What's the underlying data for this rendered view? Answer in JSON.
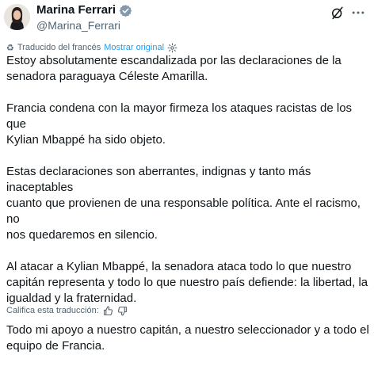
{
  "user": {
    "display_name": "Marina Ferrari",
    "handle": "@Marina_Ferrari",
    "verified_color": "#829aab"
  },
  "translation": {
    "note": "Traducido del francés",
    "show_original": "Mostrar original",
    "rate_label": "Califica esta traducción:"
  },
  "tweet": {
    "paragraphs": [
      "Estoy absolutamente escandalizada por las declaraciones de la\nsenadora paraguaya Céleste Amarilla.",
      "Francia condena con la mayor firmeza los ataques racistas de los que\nKylian Mbappé ha sido objeto.",
      "Estas declaraciones son aberrantes, indignas y tanto más inaceptables\ncuanto que provienen de una responsable política. Ante el racismo, no\nnos quedaremos en silencio.",
      "Al atacar a Kylian Mbappé, la senadora ataca todo lo que nuestro\ncapitán representa y todo lo que nuestro país defiende: la libertad, la\nigualdad y la fraternidad.",
      "Todo mi apoyo a nuestro capitán, a nuestro seleccionador y a todo el\nequipo de Francia."
    ]
  },
  "icons": {
    "verified": "verified-badge-icon",
    "grok": "grok-icon",
    "more": "more-options-icon",
    "gear": "gear-icon",
    "thumb_up": "thumbs-up-icon",
    "thumb_down": "thumbs-down-icon"
  },
  "colors": {
    "text": "#0f1419",
    "secondary": "#536471",
    "link": "#1d9bf0"
  }
}
